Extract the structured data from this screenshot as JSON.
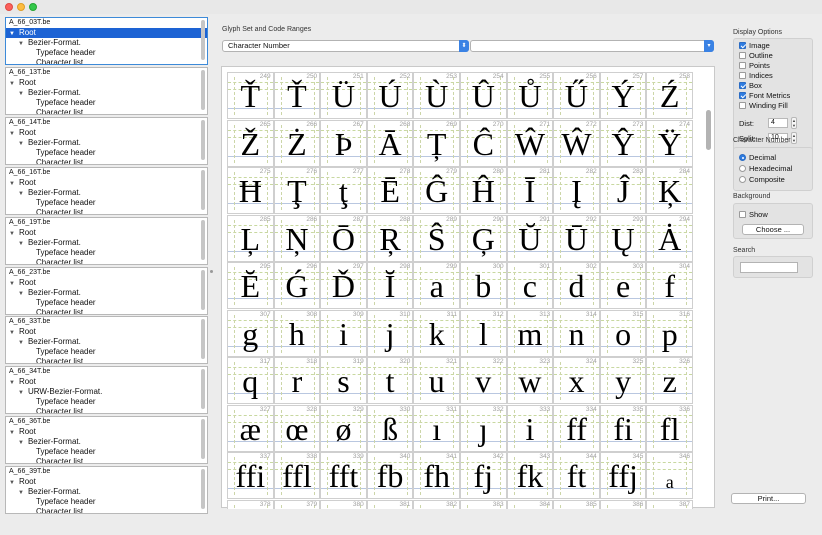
{
  "window": {
    "controls": [
      "close",
      "minimize",
      "zoom"
    ]
  },
  "font_list": [
    {
      "name": "A_66_03T.be",
      "rows": [
        {
          "label": "Root",
          "depth": 0,
          "selected": true
        },
        {
          "label": "Bezier-Format.",
          "depth": 1
        },
        {
          "label": "Typeface header",
          "depth": 2
        },
        {
          "label": "Character list",
          "depth": 2
        }
      ]
    },
    {
      "name": "A_66_13T.be",
      "rows": [
        {
          "label": "Root",
          "depth": 0
        },
        {
          "label": "Bezier-Format.",
          "depth": 1
        },
        {
          "label": "Typeface header",
          "depth": 2
        },
        {
          "label": "Character list",
          "depth": 2
        }
      ]
    },
    {
      "name": "A_66_14T.be",
      "rows": [
        {
          "label": "Root",
          "depth": 0
        },
        {
          "label": "Bezier-Format.",
          "depth": 1
        },
        {
          "label": "Typeface header",
          "depth": 2
        },
        {
          "label": "Character list",
          "depth": 2
        }
      ]
    },
    {
      "name": "A_66_16T.be",
      "rows": [
        {
          "label": "Root",
          "depth": 0
        },
        {
          "label": "Bezier-Format.",
          "depth": 1
        },
        {
          "label": "Typeface header",
          "depth": 2
        },
        {
          "label": "Character list",
          "depth": 2
        }
      ]
    },
    {
      "name": "A_66_19T.be",
      "rows": [
        {
          "label": "Root",
          "depth": 0
        },
        {
          "label": "Bezier-Format.",
          "depth": 1
        },
        {
          "label": "Typeface header",
          "depth": 2
        },
        {
          "label": "Character list",
          "depth": 2
        }
      ]
    },
    {
      "name": "A_66_23T.be",
      "rows": [
        {
          "label": "Root",
          "depth": 0
        },
        {
          "label": "Bezier-Format.",
          "depth": 1
        },
        {
          "label": "Typeface header",
          "depth": 2
        },
        {
          "label": "Character list",
          "depth": 2
        }
      ]
    },
    {
      "name": "A_66_33T.be",
      "rows": [
        {
          "label": "Root",
          "depth": 0
        },
        {
          "label": "Bezier-Format.",
          "depth": 1
        },
        {
          "label": "Typeface header",
          "depth": 2
        },
        {
          "label": "Character list",
          "depth": 2
        }
      ]
    },
    {
      "name": "A_66_34T.be",
      "rows": [
        {
          "label": "Root",
          "depth": 0
        },
        {
          "label": "URW-Bezier-Format.",
          "depth": 1
        },
        {
          "label": "Typeface header",
          "depth": 2
        },
        {
          "label": "Character list",
          "depth": 2
        }
      ]
    },
    {
      "name": "A_66_36T.be",
      "rows": [
        {
          "label": "Root",
          "depth": 0
        },
        {
          "label": "Bezier-Format.",
          "depth": 1
        },
        {
          "label": "Typeface header",
          "depth": 2
        },
        {
          "label": "Character list",
          "depth": 2
        }
      ]
    },
    {
      "name": "A_66_39T.be",
      "rows": [
        {
          "label": "Root",
          "depth": 0
        },
        {
          "label": "Bezier-Format.",
          "depth": 1
        },
        {
          "label": "Typeface header",
          "depth": 2
        },
        {
          "label": "Character list",
          "depth": 2
        }
      ]
    }
  ],
  "glyph_set": {
    "label": "Glyph Set and Code Ranges",
    "selected": "Character Number",
    "range_selected": ""
  },
  "glyph_grid": {
    "columns": 10,
    "cells": [
      {
        "n": "249",
        "g": "Ť"
      },
      {
        "n": "250",
        "g": "Ť"
      },
      {
        "n": "251",
        "g": "Ü"
      },
      {
        "n": "252",
        "g": "Ú"
      },
      {
        "n": "253",
        "g": "Ù"
      },
      {
        "n": "254",
        "g": "Û"
      },
      {
        "n": "255",
        "g": "Ů"
      },
      {
        "n": "256",
        "g": "Ű"
      },
      {
        "n": "257",
        "g": "Ý"
      },
      {
        "n": "258",
        "g": "Ź"
      },
      {
        "n": "265",
        "g": "Ž"
      },
      {
        "n": "266",
        "g": "Ż"
      },
      {
        "n": "267",
        "g": "Þ"
      },
      {
        "n": "268",
        "g": "Ā"
      },
      {
        "n": "269",
        "g": "Ț"
      },
      {
        "n": "270",
        "g": "Ĉ"
      },
      {
        "n": "271",
        "g": "Ŵ"
      },
      {
        "n": "272",
        "g": "Ŵ"
      },
      {
        "n": "273",
        "g": "Ŷ"
      },
      {
        "n": "274",
        "g": "Ÿ"
      },
      {
        "n": "275",
        "g": "Ħ"
      },
      {
        "n": "276",
        "g": "Ţ"
      },
      {
        "n": "277",
        "g": "ţ"
      },
      {
        "n": "278",
        "g": "Ē"
      },
      {
        "n": "279",
        "g": "Ĝ"
      },
      {
        "n": "280",
        "g": "Ĥ"
      },
      {
        "n": "281",
        "g": "Ī"
      },
      {
        "n": "282",
        "g": "Į"
      },
      {
        "n": "283",
        "g": "Ĵ"
      },
      {
        "n": "284",
        "g": "Ķ"
      },
      {
        "n": "285",
        "g": "Ļ"
      },
      {
        "n": "286",
        "g": "Ņ"
      },
      {
        "n": "287",
        "g": "Ō"
      },
      {
        "n": "288",
        "g": "Ŗ"
      },
      {
        "n": "289",
        "g": "Ŝ"
      },
      {
        "n": "290",
        "g": "Ģ"
      },
      {
        "n": "291",
        "g": "Ŭ"
      },
      {
        "n": "292",
        "g": "Ū"
      },
      {
        "n": "293",
        "g": "Ų"
      },
      {
        "n": "294",
        "g": "Ȧ"
      },
      {
        "n": "295",
        "g": "Ĕ"
      },
      {
        "n": "296",
        "g": "Ǵ"
      },
      {
        "n": "297",
        "g": "Ď"
      },
      {
        "n": "298",
        "g": "Ĭ"
      },
      {
        "n": "299",
        "g": "a"
      },
      {
        "n": "300",
        "g": "b"
      },
      {
        "n": "301",
        "g": "c"
      },
      {
        "n": "302",
        "g": "d"
      },
      {
        "n": "303",
        "g": "e"
      },
      {
        "n": "304",
        "g": "f"
      },
      {
        "n": "307",
        "g": "g"
      },
      {
        "n": "308",
        "g": "h"
      },
      {
        "n": "309",
        "g": "i"
      },
      {
        "n": "310",
        "g": "j"
      },
      {
        "n": "311",
        "g": "k"
      },
      {
        "n": "312",
        "g": "l"
      },
      {
        "n": "313",
        "g": "m"
      },
      {
        "n": "314",
        "g": "n"
      },
      {
        "n": "315",
        "g": "o"
      },
      {
        "n": "316",
        "g": "p"
      },
      {
        "n": "317",
        "g": "q"
      },
      {
        "n": "318",
        "g": "r"
      },
      {
        "n": "319",
        "g": "s"
      },
      {
        "n": "320",
        "g": "t"
      },
      {
        "n": "321",
        "g": "u"
      },
      {
        "n": "322",
        "g": "v"
      },
      {
        "n": "323",
        "g": "w"
      },
      {
        "n": "324",
        "g": "x"
      },
      {
        "n": "325",
        "g": "y"
      },
      {
        "n": "326",
        "g": "z"
      },
      {
        "n": "327",
        "g": "æ"
      },
      {
        "n": "328",
        "g": "œ"
      },
      {
        "n": "329",
        "g": "ø"
      },
      {
        "n": "330",
        "g": "ß"
      },
      {
        "n": "331",
        "g": "ı"
      },
      {
        "n": "332",
        "g": "ȷ"
      },
      {
        "n": "333",
        "g": "i"
      },
      {
        "n": "334",
        "g": "ff"
      },
      {
        "n": "335",
        "g": "fi"
      },
      {
        "n": "336",
        "g": "fl"
      },
      {
        "n": "337",
        "g": "ffi"
      },
      {
        "n": "338",
        "g": "ffl"
      },
      {
        "n": "339",
        "g": "fft"
      },
      {
        "n": "340",
        "g": "fb"
      },
      {
        "n": "341",
        "g": "fh"
      },
      {
        "n": "342",
        "g": "fj"
      },
      {
        "n": "343",
        "g": "fk"
      },
      {
        "n": "344",
        "g": "ft"
      },
      {
        "n": "345",
        "g": "ffj"
      },
      {
        "n": "346",
        "g": "a",
        "small": true
      },
      {
        "n": "378",
        "g": ""
      },
      {
        "n": "379",
        "g": ""
      },
      {
        "n": "380",
        "g": ""
      },
      {
        "n": "381",
        "g": ""
      },
      {
        "n": "382",
        "g": ""
      },
      {
        "n": "383",
        "g": ""
      },
      {
        "n": "384",
        "g": ""
      },
      {
        "n": "385",
        "g": ""
      },
      {
        "n": "386",
        "g": ""
      },
      {
        "n": "387",
        "g": ""
      }
    ]
  },
  "display_options": {
    "label": "Display Options",
    "items": [
      {
        "label": "Image",
        "checked": true
      },
      {
        "label": "Outline",
        "checked": false
      },
      {
        "label": "Points",
        "checked": false
      },
      {
        "label": "Indices",
        "checked": false
      },
      {
        "label": "Box",
        "checked": true
      },
      {
        "label": "Font Metrics",
        "checked": true
      },
      {
        "label": "Winding Fill",
        "checked": false
      }
    ],
    "dist_label": "Dist:",
    "dist_value": "4",
    "split_label": "Split:",
    "split_value": "10"
  },
  "character_number": {
    "label": "Character Number",
    "options": [
      {
        "label": "Decimal",
        "selected": true
      },
      {
        "label": "Hexadecimal",
        "selected": false
      },
      {
        "label": "Composite",
        "selected": false
      }
    ]
  },
  "background": {
    "label": "Background",
    "show_label": "Show",
    "show_checked": false,
    "choose_label": "Choose ..."
  },
  "search": {
    "label": "Search",
    "value": ""
  },
  "print_label": "Print...",
  "colors": {
    "selection": "#1d63d4",
    "accent": "#3a82e4",
    "window_bg": "#ececec"
  }
}
